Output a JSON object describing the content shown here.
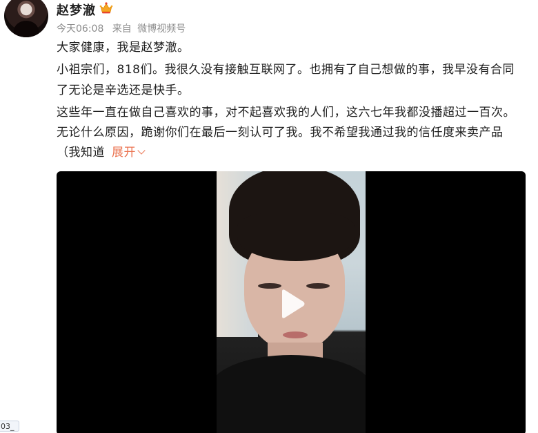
{
  "post": {
    "author": {
      "name": "赵梦澈",
      "avatar_icon": "user-avatar",
      "badge_icon": "vip-crown-icon",
      "badge_color": "#f5a623"
    },
    "meta": {
      "time": "今天06:08",
      "source_prefix": "来自",
      "source": "微博视频号"
    },
    "body": {
      "p1": "大家健康，我是赵梦澈。",
      "p2": "小祖宗们，818们。我很久没有接触互联网了。也拥有了自己想做的事，我早没有合同\n了无论是辛选还是快手。",
      "p3": "这些年一直在做自己喜欢的事，对不起喜欢我的人们，这六七年我都没播超过一百次。\n无论什么原因，跪谢你们在最后一刻认可了我。我不希望我通过我的信任度来卖产品\n（我知道",
      "expand_label": "展开",
      "expand_color": "#eb7350"
    },
    "video": {
      "play_icon": "play-icon"
    }
  },
  "side_badge": {
    "text": "03_"
  }
}
